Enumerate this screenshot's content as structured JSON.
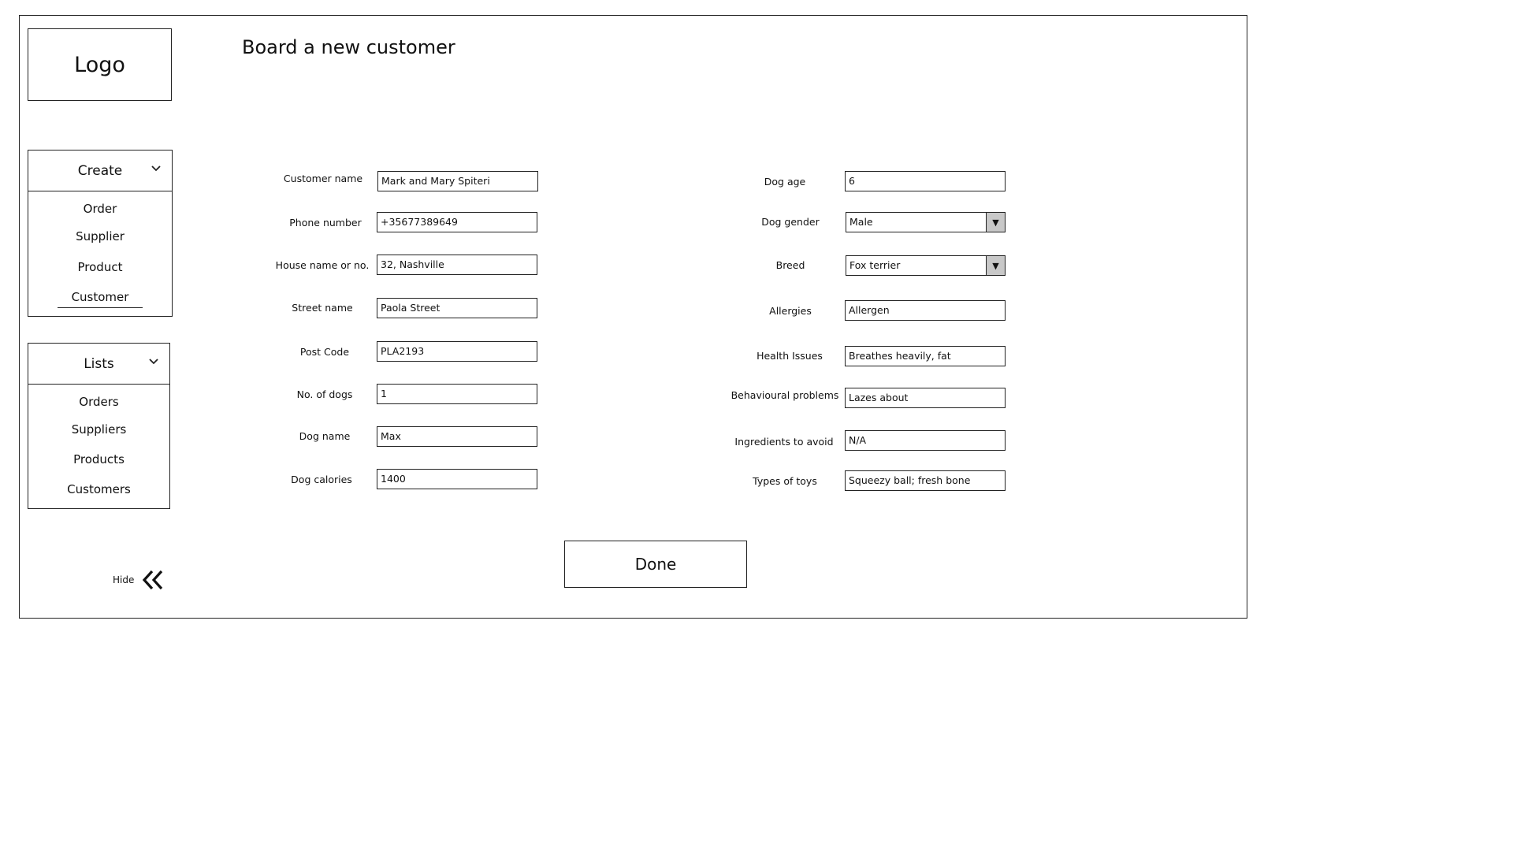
{
  "logo": {
    "text": "Logo"
  },
  "page_title": "Board a new customer",
  "create_menu": {
    "title": "Create",
    "items": [
      "Order",
      "Supplier",
      "Product",
      "Customer"
    ],
    "active": "Customer"
  },
  "lists_menu": {
    "title": "Lists",
    "items": [
      "Orders",
      "Suppliers",
      "Products",
      "Customers"
    ]
  },
  "hide": {
    "label": "Hide"
  },
  "left_fields": [
    {
      "label": "Customer name",
      "value": "Mark and Mary Spiteri"
    },
    {
      "label": "Phone number",
      "value": "+35677389649"
    },
    {
      "label": "House name or no.",
      "value": "32, Nashville"
    },
    {
      "label": "Street name",
      "value": "Paola Street"
    },
    {
      "label": "Post Code",
      "value": "PLA2193"
    },
    {
      "label": "No. of dogs",
      "value": "1"
    },
    {
      "label": "Dog name",
      "value": "Max"
    },
    {
      "label": "Dog calories",
      "value": "1400"
    }
  ],
  "right_fields": [
    {
      "label": "Dog age",
      "value": "6",
      "type": "input"
    },
    {
      "label": "Dog gender",
      "value": "Male",
      "type": "select"
    },
    {
      "label": "Breed",
      "value": "Fox terrier",
      "type": "select"
    },
    {
      "label": "Allergies",
      "value": "Allergen",
      "type": "input"
    },
    {
      "label": "Health Issues",
      "value": "Breathes heavily, fat",
      "type": "input"
    },
    {
      "label": "Behavioural problems",
      "value": "Lazes about",
      "type": "input"
    },
    {
      "label": "Ingredients to avoid",
      "value": "N/A",
      "type": "input"
    },
    {
      "label": "Types of toys",
      "value": "Squeezy ball; fresh bone",
      "type": "input"
    }
  ],
  "done_button": {
    "label": "Done"
  },
  "icons": {
    "create_chevron": "chevron-down-icon",
    "lists_chevron": "chevron-down-icon",
    "hide": "double-chevron-left-icon",
    "select_arrow": "triangle-down-icon"
  }
}
